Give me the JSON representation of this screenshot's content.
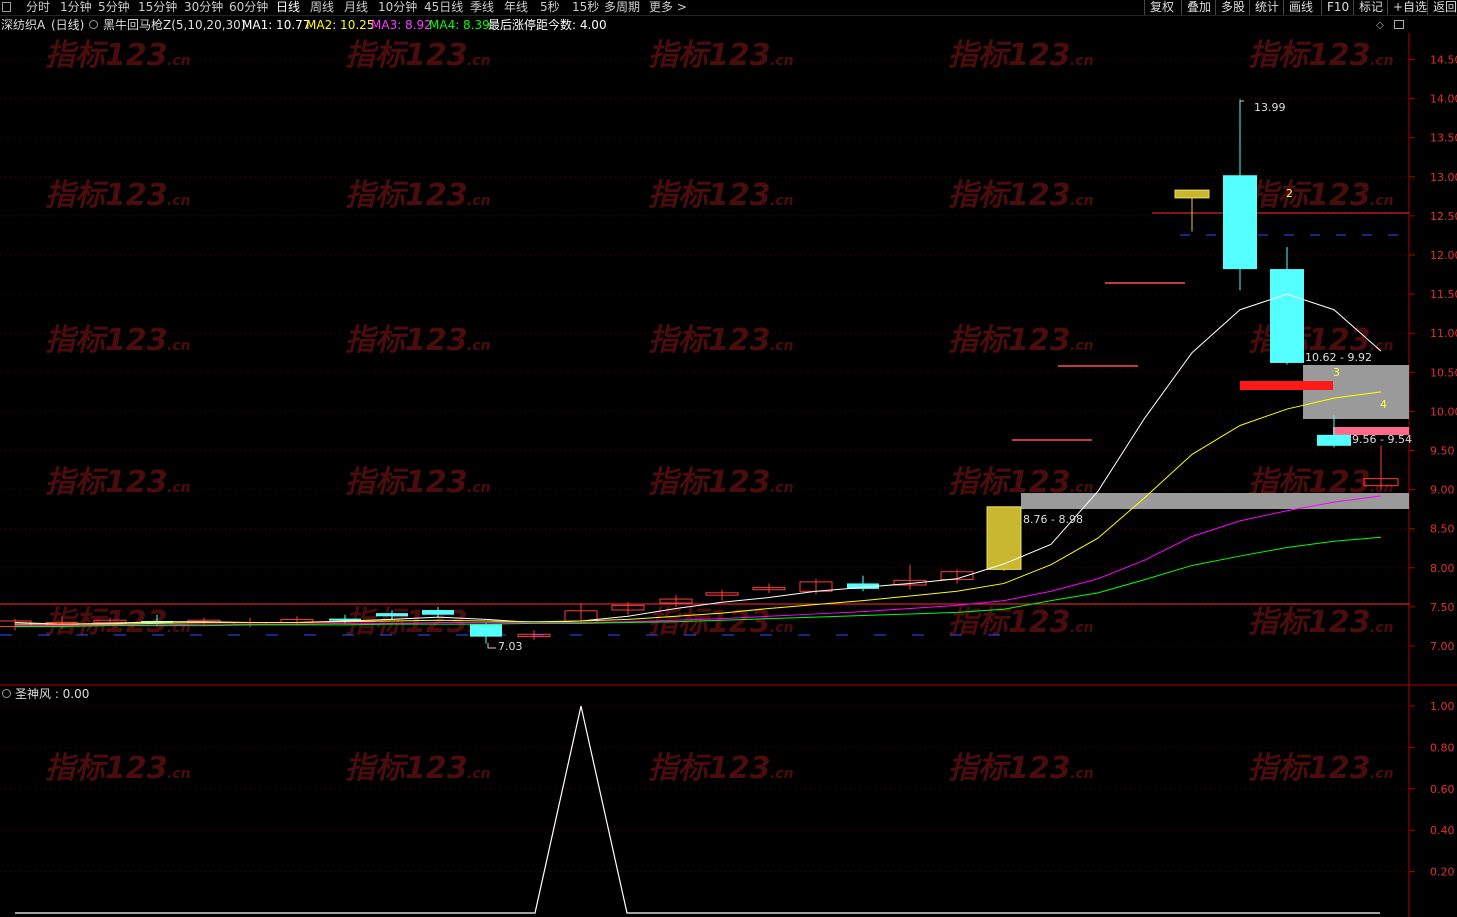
{
  "toolbar": {
    "periods": [
      "分时",
      "1分钟",
      "5分钟",
      "15分钟",
      "30分钟",
      "60分钟",
      "日线",
      "周线",
      "月线",
      "10分钟",
      "45日线",
      "季线",
      "年线",
      "5秒",
      "15秒",
      "多周期",
      "更多 >"
    ],
    "active_period": "日线",
    "actions": [
      "复权",
      "叠加",
      "多股",
      "统计",
      "画线",
      "F10",
      "标记",
      "+自选",
      "返回"
    ]
  },
  "main_panel": {
    "stock_name": "深纺织A",
    "period_label": "(日线)",
    "indicator": "黑牛回马枪Z(5,10,20,30)",
    "ma1_label": "MA1: 10.77",
    "ma2_label": "MA2: 10.25",
    "ma3_label": "MA3: 8.92",
    "ma4_label": "MA4: 8.39",
    "limit_text": "最后涨停距今数: 4.00",
    "y_ticks": [
      "14.50",
      "14.00",
      "13.50",
      "13.00",
      "12.50",
      "12.00",
      "11.50",
      "11.00",
      "10.50",
      "10.00",
      "9.50",
      "9.00",
      "8.50",
      "8.00",
      "7.50",
      "7.00"
    ],
    "high_label": "13.99",
    "low_label": "7.03",
    "zone_labels": [
      "8.76 - 8.98",
      "10.62 - 9.92",
      "9.56 - 9.54"
    ],
    "marker_labels": [
      "2",
      "3",
      "4"
    ]
  },
  "sub_panel": {
    "indicator_label": "圣神风 : 0.00",
    "y_ticks": [
      "1.00",
      "0.80",
      "0.60",
      "0.40",
      "0.20"
    ]
  },
  "watermark": {
    "text": "指标123",
    "suffix": ".cn"
  },
  "colors": {
    "ma1": "#ffffff",
    "ma2": "#ffff00",
    "ma3": "#ff00ff",
    "ma4": "#00ff00",
    "up": "#ff3c3c",
    "down": "#54ffff",
    "axis": "#b00000"
  }
}
